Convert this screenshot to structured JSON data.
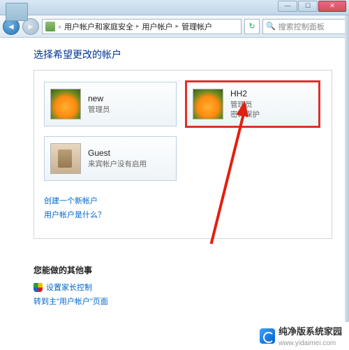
{
  "titlebar": {
    "btn_min": "—",
    "btn_max": "☐",
    "btn_close": "✕"
  },
  "nav": {
    "back": "◄",
    "fwd": "►"
  },
  "breadcrumb": {
    "seg1": "用户帐户和家庭安全",
    "seg2": "用户帐户",
    "seg3": "管理帐户"
  },
  "search": {
    "placeholder": "搜索控制面板"
  },
  "heading": "选择希望更改的帐户",
  "accounts": [
    {
      "name": "new",
      "meta1": "管理员",
      "meta2": ""
    },
    {
      "name": "HH2",
      "meta1": "管理员",
      "meta2": "密码保护"
    },
    {
      "name": "Guest",
      "meta1": "来宾帐户没有启用",
      "meta2": ""
    }
  ],
  "links": {
    "create": "创建一个新帐户",
    "what": "用户帐户是什么？"
  },
  "other": {
    "heading": "您能做的其他事",
    "parental": "设置家长控制",
    "goto_main": "转到主\"用户帐户\"页面"
  },
  "watermark": {
    "title": "纯净版系统家园",
    "sub": "www.yidaimei.com"
  }
}
